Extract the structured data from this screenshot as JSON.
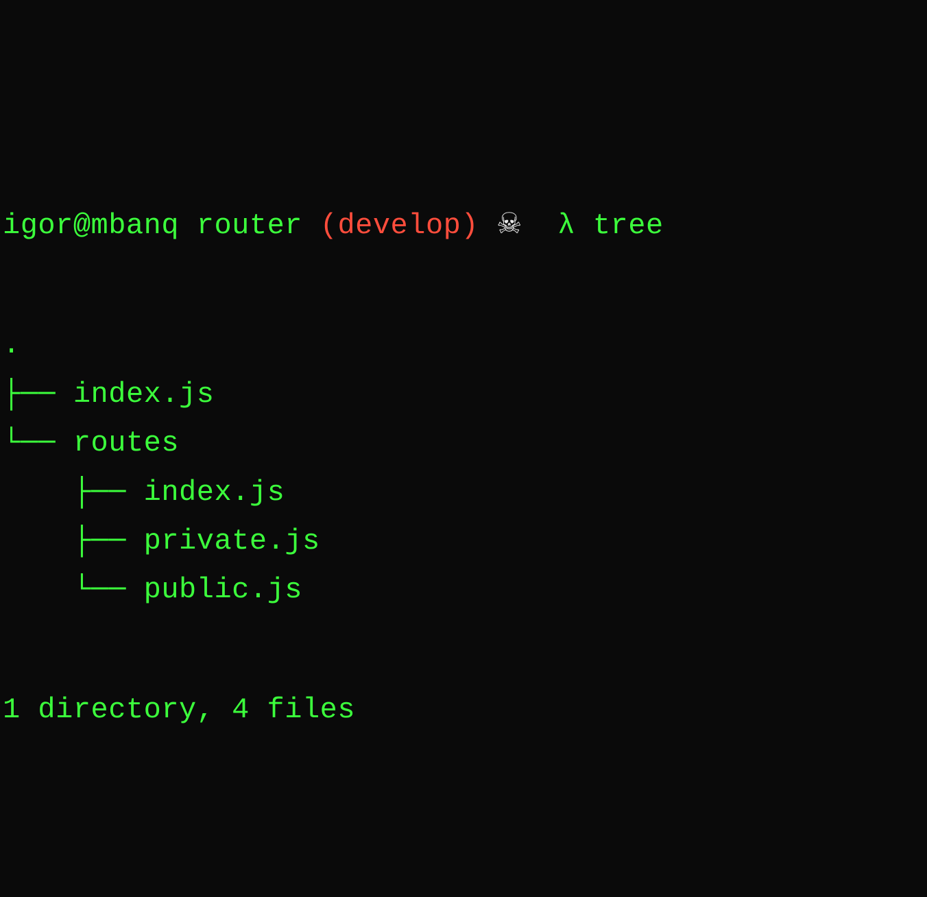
{
  "prompt": {
    "user_host": "igor@mbanq",
    "directory": "router",
    "branch_open": "(",
    "branch_name": "develop",
    "branch_close": ")",
    "status_icon": "☠",
    "lambda_symbol": "λ",
    "command": "tree"
  },
  "tree": {
    "root": ".",
    "lines": [
      {
        "prefix": "├── ",
        "name": "index.js"
      },
      {
        "prefix": "└── ",
        "name": "routes"
      },
      {
        "prefix": "    ├── ",
        "name": "index.js"
      },
      {
        "prefix": "    ├── ",
        "name": "private.js"
      },
      {
        "prefix": "    └── ",
        "name": "public.js"
      }
    ]
  },
  "summary": "1 directory, 4 files"
}
